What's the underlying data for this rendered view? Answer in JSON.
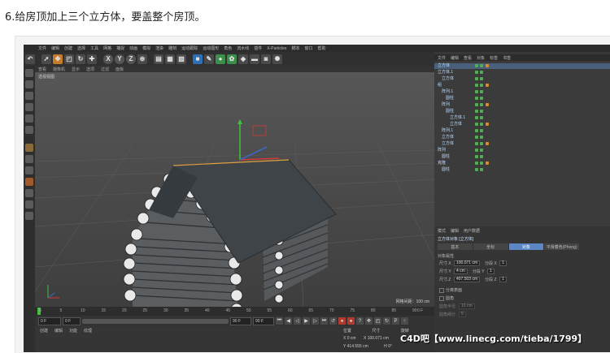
{
  "step_text": "6.给房顶加上三个立方体，要盖整个房顶。",
  "menu": [
    "文件",
    "编辑",
    "创建",
    "选择",
    "工具",
    "网格",
    "捕捉",
    "动画",
    "模拟",
    "渲染",
    "雕刻",
    "运动跟踪",
    "运动图形",
    "角色",
    "流水线",
    "插件",
    "X-Particles",
    "脚本",
    "窗口",
    "帮助"
  ],
  "toolbar_letters": {
    "x": "X",
    "y": "Y",
    "z": "Z"
  },
  "viewport": {
    "tabs": [
      "查看",
      "摄像机",
      "显示",
      "选项",
      "过滤",
      "面板"
    ],
    "label": "透视视图",
    "scale": "网格间距：100 cm"
  },
  "timeline": {
    "ticks": [
      "0",
      "5",
      "10",
      "15",
      "20",
      "25",
      "30",
      "35",
      "40",
      "45",
      "50",
      "55",
      "60",
      "65",
      "70",
      "75",
      "80",
      "85",
      "90"
    ],
    "end_label": "0 F"
  },
  "transport": {
    "start": "0 F",
    "current": "0 F",
    "end": "90 F",
    "end2": "90 F"
  },
  "materials": {
    "tabs": [
      "创建",
      "编辑",
      "功能",
      "纹理"
    ]
  },
  "coords": {
    "header_pos": "位置",
    "header_size": "尺寸",
    "header_rot": "旋转",
    "x_pos": "0 cm",
    "x_size": "100.071 cm",
    "y_pos": "414.555 cm",
    "h": "0°"
  },
  "right": {
    "tabs": [
      "文件",
      "编辑",
      "查看",
      "对象",
      "标签",
      "书签"
    ],
    "hierarchy": [
      {
        "name": "立方体",
        "indent": 0
      },
      {
        "name": "立方体.1",
        "indent": 0
      },
      {
        "name": "立方体",
        "indent": 1
      },
      {
        "name": "组",
        "indent": 0
      },
      {
        "name": "阵列.1",
        "indent": 1
      },
      {
        "name": "圆柱",
        "indent": 2
      },
      {
        "name": "阵列",
        "indent": 1
      },
      {
        "name": "圆柱",
        "indent": 2
      },
      {
        "name": "立方体.1",
        "indent": 3
      },
      {
        "name": "立方体",
        "indent": 3
      },
      {
        "name": "阵列.1",
        "indent": 1
      },
      {
        "name": "立方体",
        "indent": 1
      },
      {
        "name": "立方体",
        "indent": 1
      },
      {
        "name": "阵列",
        "indent": 0
      },
      {
        "name": "圆柱",
        "indent": 1
      },
      {
        "name": "克隆",
        "indent": 0
      },
      {
        "name": "圆柱",
        "indent": 1
      }
    ]
  },
  "attributes": {
    "tabs": [
      "模式",
      "编辑",
      "用户数据"
    ],
    "object_name": "立方体对象 [立方体]",
    "sections": [
      "基本",
      "坐标",
      "对象",
      "平滑着色(Phong)"
    ],
    "active_section": "对象",
    "props_title": "对象属性",
    "size_x_label": "尺寸.X",
    "size_x": "100.071 cm",
    "seg_x_label": "分段 X",
    "seg_x": "1",
    "size_y_label": "尺寸.Y",
    "size_y": "4 cm",
    "seg_y_label": "分段 Y",
    "seg_y": "1",
    "size_z_label": "尺寸.Z",
    "size_z": "407.503 cm",
    "seg_z_label": "分段 Z",
    "seg_z": "1",
    "sep_label": "分离表面",
    "fillet_label": "圆角",
    "fillet_radius_label": "圆角半径",
    "fillet_radius": "10 cm",
    "fillet_sub_label": "圆角细分",
    "fillet_sub": "5"
  },
  "watermark": "C4D吧【www.linecg.com/tieba/1799】",
  "colors": {
    "ui_bg": "#3a3a3a",
    "viewport": "#4b4b4b",
    "roof": "#3f4449",
    "accent_blue": "#5c87c4",
    "selection_orange": "#e08a2a"
  }
}
